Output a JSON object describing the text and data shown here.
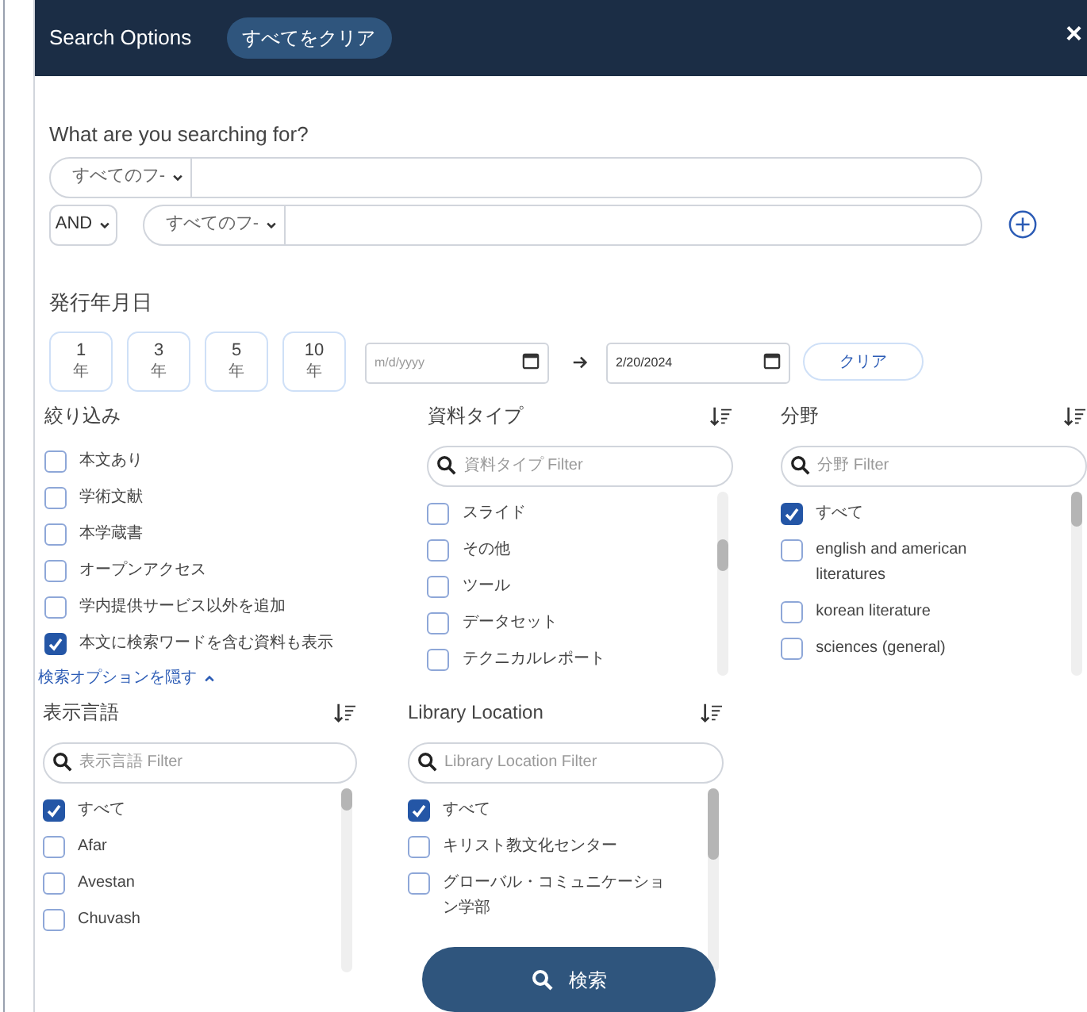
{
  "header": {
    "title": "Search Options",
    "clear_all": "すべてをクリア",
    "close": "×"
  },
  "query": {
    "heading": "What are you searching for?",
    "rows": [
      {
        "field": "すべてのフ-"
      },
      {
        "operator": "AND",
        "field": "すべてのフ-"
      }
    ]
  },
  "date": {
    "heading": "発行年月日",
    "ranges": [
      {
        "number": "1",
        "unit": "年"
      },
      {
        "number": "3",
        "unit": "年"
      },
      {
        "number": "5",
        "unit": "年"
      },
      {
        "number": "10",
        "unit": "年"
      }
    ],
    "from": {
      "placeholder": "m/d/yyyy"
    },
    "to": {
      "value": "2/20/2024"
    },
    "clear": "クリア"
  },
  "facets": [
    {
      "title": "絞り込み",
      "items": [
        {
          "label": "本文あり",
          "checked": false
        },
        {
          "label": "学術文献",
          "checked": false
        },
        {
          "label": "本学蔵書",
          "checked": false
        },
        {
          "label": "オープンアクセス",
          "checked": false
        },
        {
          "label": "学内提供サービス以外を追加",
          "checked": false
        },
        {
          "label": "本文に検索ワードを含む資料も表示",
          "checked": true
        }
      ],
      "link": "検索オプションを隠す"
    },
    {
      "title": "資料タイプ",
      "placeholder": "資料タイプ Filter",
      "items": [
        {
          "label": "スライド",
          "checked": false
        },
        {
          "label": "その他",
          "checked": false
        },
        {
          "label": "ツール",
          "checked": false
        },
        {
          "label": "データセット",
          "checked": false
        },
        {
          "label": "テクニカルレポート",
          "checked": false
        }
      ]
    },
    {
      "title": "分野",
      "placeholder": "分野 Filter",
      "items": [
        {
          "label": "すべて",
          "checked": true
        },
        {
          "label": "english and american literatures",
          "checked": false
        },
        {
          "label": "korean literature",
          "checked": false
        },
        {
          "label": "sciences (general)",
          "checked": false
        }
      ]
    },
    {
      "title": "表示言語",
      "placeholder": "表示言語 Filter",
      "items": [
        {
          "label": "すべて",
          "checked": true
        },
        {
          "label": "Afar",
          "checked": false
        },
        {
          "label": "Avestan",
          "checked": false
        },
        {
          "label": "Chuvash",
          "checked": false
        }
      ]
    },
    {
      "title": "Library Location",
      "placeholder": "Library Location Filter",
      "items": [
        {
          "label": "すべて",
          "checked": true
        },
        {
          "label": "キリスト教文化センター",
          "checked": false
        },
        {
          "label": "グローバル・コミュニケーション学部",
          "checked": false
        }
      ]
    }
  ],
  "search_button": "検索"
}
